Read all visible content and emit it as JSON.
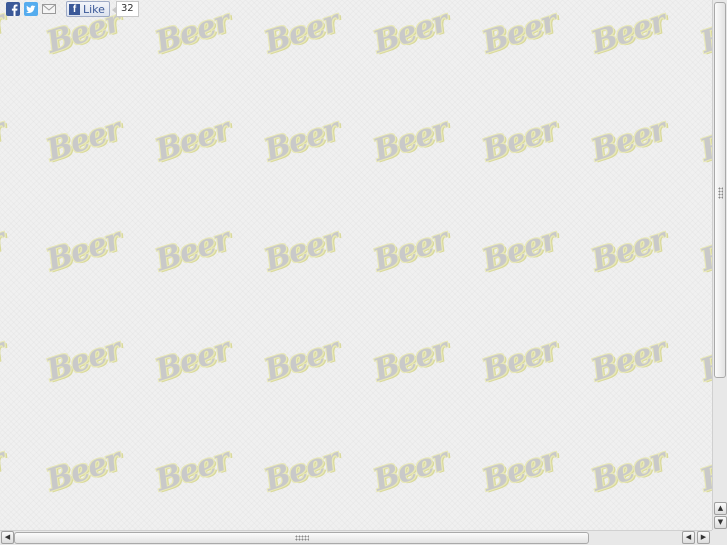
{
  "background": {
    "tile_text": "Beer",
    "colors": {
      "page": "#f0f0f0",
      "tile_fill": "#c9c9c9",
      "tile_outline": "#e8e8b8"
    }
  },
  "social": {
    "icons": [
      "facebook-icon",
      "twitter-icon",
      "email-icon"
    ],
    "like_label": "Like",
    "like_count": "32",
    "colors": {
      "facebook": "#3b5998",
      "twitter": "#55acee"
    }
  },
  "scrollbars": {
    "vertical": {
      "up": "▲",
      "down": "▼"
    },
    "horizontal": {
      "left": "◀",
      "right": "▶"
    }
  }
}
